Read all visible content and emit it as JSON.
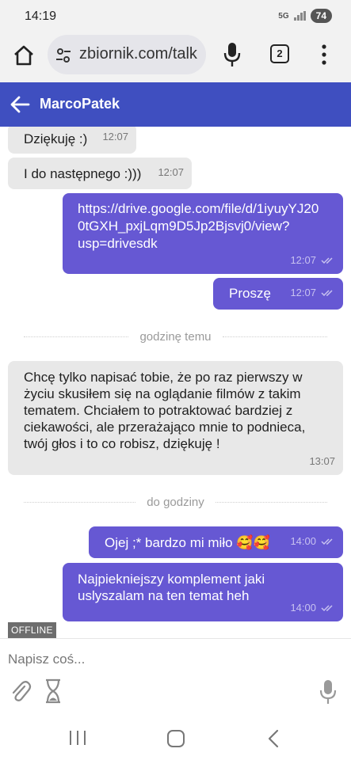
{
  "status_bar": {
    "time": "14:19",
    "network": "5G",
    "battery": "74"
  },
  "browser": {
    "url": "zbiornik.com/talk",
    "tab_count": "2"
  },
  "chat_header": {
    "contact_name": "MarcoPatek"
  },
  "messages": [
    {
      "direction": "in",
      "text": "Dziękuję :)",
      "time": "12:07"
    },
    {
      "direction": "in",
      "text": "I do następnego :)))",
      "time": "12:07"
    },
    {
      "direction": "out",
      "text": "https://drive.google.com/file/d/1iyuyYJ20 0tGXH_pxjLqm9D5Jp2Bjsvj0/view? usp=drivesdk",
      "time": "12:07",
      "read": true
    },
    {
      "direction": "out",
      "text": "Proszę",
      "time": "12:07",
      "read": true
    },
    {
      "direction": "in",
      "text": "Chcę tylko napisać tobie, że po raz pierwszy w życiu skusiłem się na oglądanie filmów z takim tematem. Chciałem to potraktować bardziej z ciekawości, ale przerażająco mnie to podnieca, twój głos i to co robisz, dziękuję !",
      "time": "13:07"
    },
    {
      "direction": "out",
      "text": "Ojej ;* bardzo mi miło 🥰🥰",
      "time": "14:00",
      "read": true
    },
    {
      "direction": "out",
      "text": "Najpiekniejszy komplement jaki uslyszalam na ten temat heh",
      "time": "14:00",
      "read": true
    }
  ],
  "dividers": [
    "godzinę temu",
    "do godziny"
  ],
  "presence": "OFFLINE",
  "composer": {
    "placeholder": "Napisz coś..."
  },
  "icons": {
    "home": "home-icon",
    "tune": "tune-icon",
    "mic": "mic-icon",
    "tabs": "tabs-icon",
    "menu": "more-vert-icon",
    "back": "arrow-back-icon",
    "read": "double-check-icon",
    "attach": "paperclip-icon",
    "timer": "hourglass-icon",
    "nav_recent": "recent-apps-icon",
    "nav_home": "nav-home-icon",
    "nav_back": "nav-back-icon"
  },
  "colors": {
    "header": "#3f4fc0",
    "outgoing_bubble": "#6658d3",
    "incoming_bubble": "#e8e8e8",
    "offline_badge": "#6d6d6d"
  }
}
